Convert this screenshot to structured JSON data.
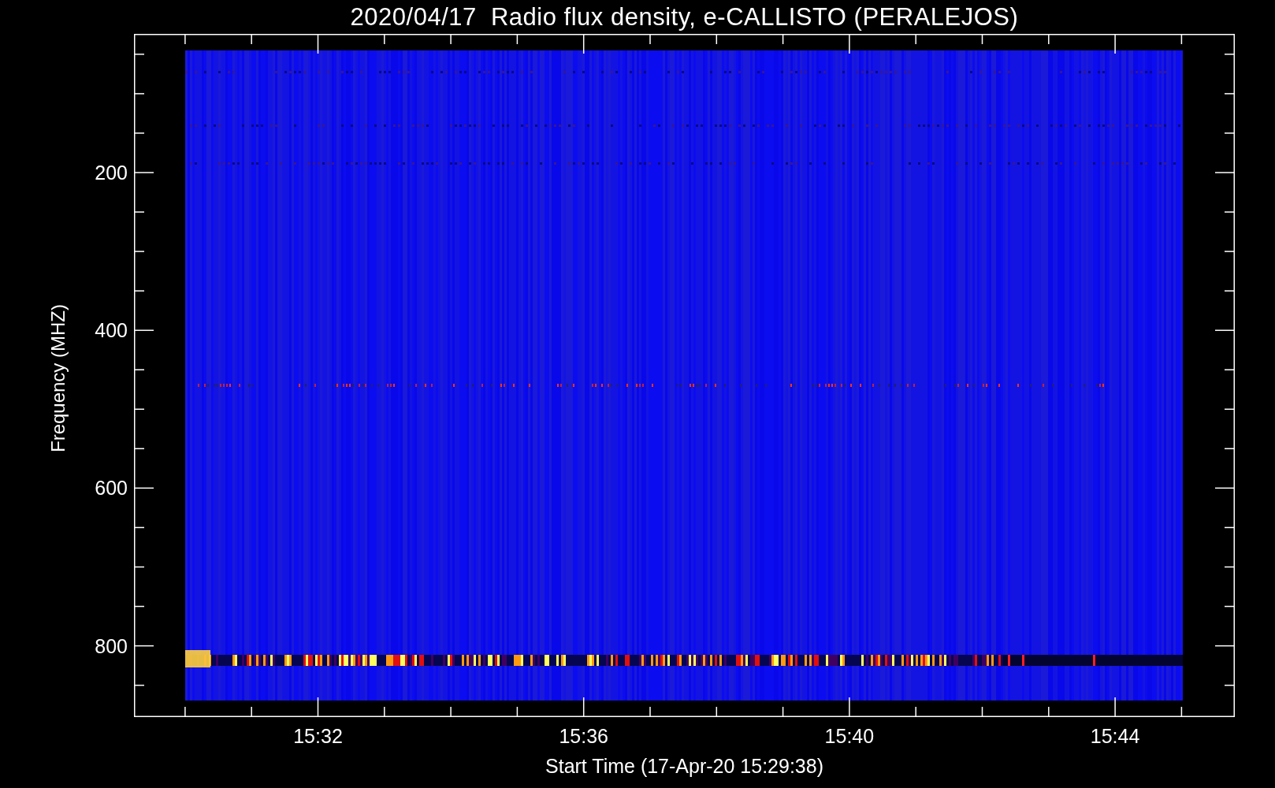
{
  "title": "2020/04/17  Radio flux density, e-CALLISTO (PERALEJOS)",
  "y_axis": {
    "label": "Frequency (MHZ)",
    "tick_labels": [
      "200",
      "400",
      "600",
      "800"
    ]
  },
  "x_axis": {
    "label": "Start Time (17-Apr-20 15:29:38)",
    "tick_labels": [
      "15:32",
      "15:36",
      "15:40",
      "15:44"
    ]
  }
}
